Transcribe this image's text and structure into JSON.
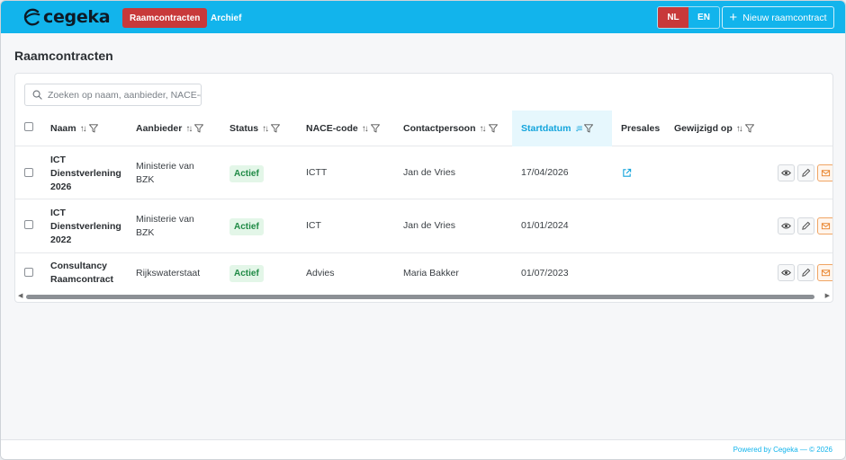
{
  "app": {
    "logo_text": "cegeka",
    "nav_active": "Raamcontracten",
    "nav_archive": "Archief",
    "lang_nl": "NL",
    "lang_en": "EN",
    "new_button": "Nieuw raamcontract"
  },
  "page": {
    "title": "Raamcontracten",
    "search_placeholder": "Zoeken op naam, aanbieder, NACE-code..."
  },
  "table": {
    "columns": {
      "naam": "Naam",
      "aanbieder": "Aanbieder",
      "status": "Status",
      "nace": "NACE-code",
      "contact": "Contactpersoon",
      "startdatum": "Startdatum",
      "presales": "Presales",
      "gewijzigd": "Gewijzigd op"
    },
    "rows": [
      {
        "naam": "ICT Dienstverlening 2026",
        "aanbieder": "Ministerie van BZK",
        "status": "Actief",
        "nace": "ICTT",
        "contact": "Jan de Vries",
        "startdatum": "17/04/2026",
        "presales_link": true
      },
      {
        "naam": "ICT Dienstverlening 2022",
        "aanbieder": "Ministerie van BZK",
        "status": "Actief",
        "nace": "ICT",
        "contact": "Jan de Vries",
        "startdatum": "01/01/2024",
        "presales_link": false
      },
      {
        "naam": "Consultancy Raamcontract",
        "aanbieder": "Rijkswaterstaat",
        "status": "Actief",
        "nace": "Advies",
        "contact": "Maria Bakker",
        "startdatum": "01/07/2023",
        "presales_link": false
      }
    ]
  },
  "footer": {
    "text": "Powered by Cegeka — © 2026"
  },
  "colors": {
    "topbar": "#12b4ec",
    "accent_red": "#c8393a",
    "status_green": "#1f8a45",
    "sorted_column_bg": "#e6f7fd"
  },
  "icons": {
    "search": "search-icon",
    "filter": "filter-icon",
    "external_link": "external-link-icon",
    "view": "eye-icon",
    "edit": "pencil-icon",
    "mail": "envelope-icon"
  }
}
